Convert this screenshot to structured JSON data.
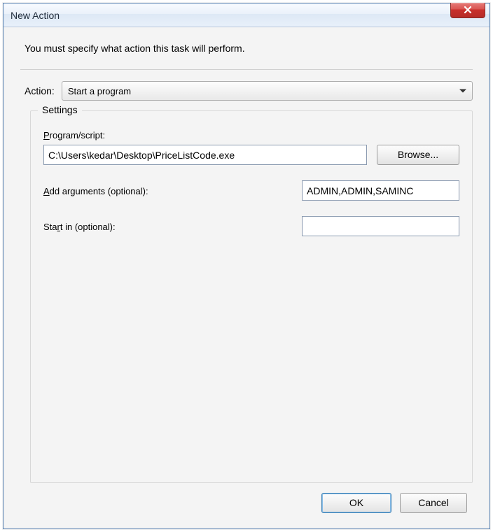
{
  "titlebar": {
    "title": "New Action",
    "close_icon": "close-icon"
  },
  "instruction": "You must specify what action this task will perform.",
  "action": {
    "label": "Action:",
    "selected": "Start a program"
  },
  "settings": {
    "legend": "Settings",
    "program_label_pre": "P",
    "program_label_post": "rogram/script:",
    "program_value": "C:\\Users\\kedar\\Desktop\\PriceListCode.exe",
    "browse_label": "Browse...",
    "args_label_pre": "A",
    "args_label_post": "dd arguments (optional):",
    "args_value": "ADMIN,ADMIN,SAMINC",
    "startin_label_pre": "Sta",
    "startin_accel": "r",
    "startin_label_post": "t in (optional):",
    "startin_value": ""
  },
  "buttons": {
    "ok": "OK",
    "cancel": "Cancel"
  }
}
